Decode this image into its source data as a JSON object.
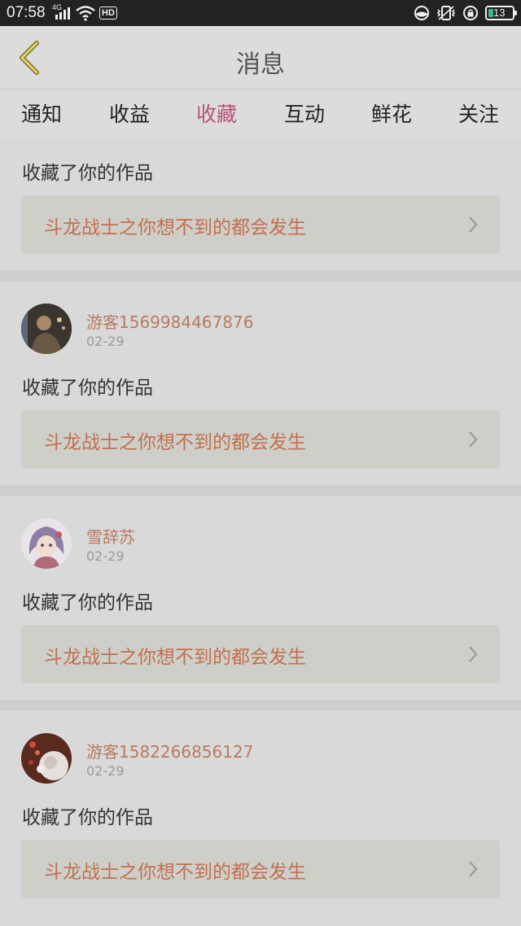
{
  "status_bar": {
    "time": "07:58",
    "network": "4G",
    "hd": "HD",
    "battery": "13",
    "accent": "#3fb88f"
  },
  "header": {
    "title": "消息",
    "back_icon": "chevron-left-icon"
  },
  "tabs": [
    {
      "label": "通知",
      "active": false
    },
    {
      "label": "收益",
      "active": false
    },
    {
      "label": "收藏",
      "active": true
    },
    {
      "label": "互动",
      "active": false
    },
    {
      "label": "鲜花",
      "active": false
    },
    {
      "label": "关注",
      "active": false
    }
  ],
  "colors": {
    "accent": "#b5537a",
    "user_name": "#b77b60",
    "work_title": "#c1704e"
  },
  "items": [
    {
      "user": "",
      "date": "",
      "action": "收藏了你的作品",
      "work": "斗龙战士之你想不到的都会发生"
    },
    {
      "user": "游客1569984467876",
      "date": "02-29",
      "action": "收藏了你的作品",
      "work": "斗龙战士之你想不到的都会发生"
    },
    {
      "user": "雪辞苏",
      "date": "02-29",
      "action": "收藏了你的作品",
      "work": "斗龙战士之你想不到的都会发生"
    },
    {
      "user": "游客1582266856127",
      "date": "02-29",
      "action": "收藏了你的作品",
      "work": "斗龙战士之你想不到的都会发生"
    }
  ]
}
